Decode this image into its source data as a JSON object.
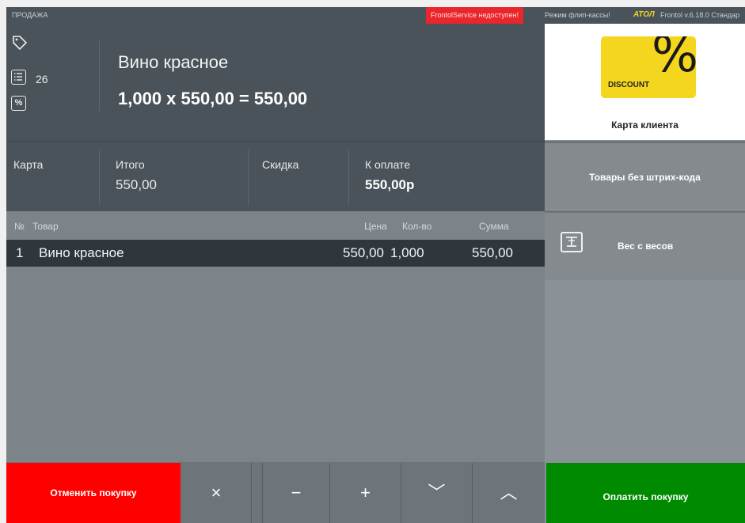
{
  "topbar": {
    "mode": "ПРОДАЖА",
    "service_error": "FrontolService недоступен!",
    "flip_mode": "Режим флип-кассы!",
    "brand": "АТОЛ",
    "version": "Frontol v.6.18.0 Стандар"
  },
  "header": {
    "icons": [
      "tag-icon",
      "list-icon",
      "percent-icon"
    ],
    "position_count": "26",
    "item_name": "Вино красное",
    "calculation": "1,000 x 550,00 = 550,00"
  },
  "totals": {
    "card_label": "Карта",
    "total_label": "Итого",
    "total_value": "550,00",
    "discount_label": "Скидка",
    "to_pay_label": "К оплате",
    "to_pay_value": "550,00р"
  },
  "grid": {
    "columns": {
      "num": "№",
      "item": "Товар",
      "price": "Цена",
      "qty": "Кол-во",
      "sum": "Сумма"
    },
    "rows": [
      {
        "num": "1",
        "item": "Вино красное",
        "price": "550,00",
        "qty": "1,000",
        "sum": "550,00"
      }
    ]
  },
  "right_panel": {
    "discount_badge_text": "DISCOUNT",
    "discount_badge_symbol": "%",
    "client_card_label": "Карта клиента",
    "no_barcode_label": "Товары без штрих-кода",
    "weight_label": "Вес с весов"
  },
  "actions": {
    "cancel_label": "Отменить покупку",
    "delete_symbol": "×",
    "minus_symbol": "−",
    "plus_symbol": "+",
    "down_symbol": "﹀",
    "up_symbol": "︿",
    "pay_label": "Оплатить покупку"
  },
  "colors": {
    "cancel": "#ff0000",
    "pay": "#008a00",
    "error_badge": "#e8262b",
    "discount_badge": "#f5d61e"
  }
}
